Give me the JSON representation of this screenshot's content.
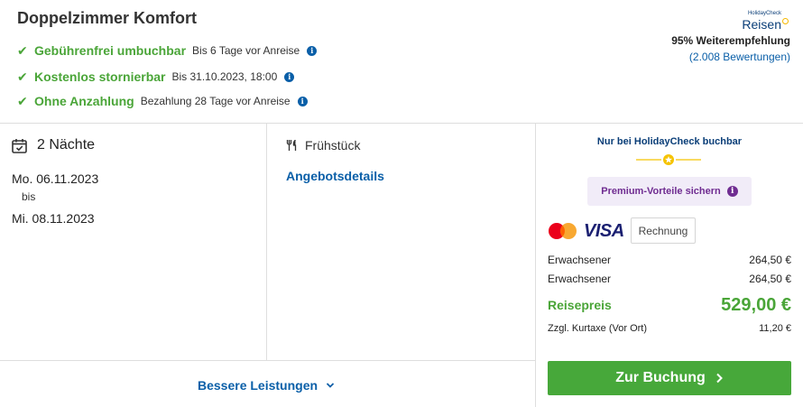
{
  "offer": {
    "title": "Doppelzimmer Komfort",
    "features": [
      {
        "name": "Gebührenfrei umbuchbar",
        "desc": "Bis 6 Tage vor Anreise",
        "info": "i"
      },
      {
        "name": "Kostenlos stornierbar",
        "desc": "Bis 31.10.2023, 18:00",
        "info": "i"
      },
      {
        "name": "Ohne Anzahlung",
        "desc": "Bezahlung 28 Tage vor Anreise",
        "info": "i"
      }
    ]
  },
  "brand": {
    "logo_small": "HolidayCheck",
    "logo_big": "Reisen",
    "recommendation": "95% Weiterempfehlung",
    "reviews": "(2.008 Bewertungen)"
  },
  "stay": {
    "nights_label": "2 Nächte",
    "start_date": "Mo. 06.11.2023",
    "bis": "bis",
    "end_date": "Mi. 08.11.2023"
  },
  "board": {
    "label": "Frühstück",
    "icon": "cutlery-icon",
    "offer_details_link": "Angebotsdetails"
  },
  "footer": {
    "better_services": "Bessere Leistungen"
  },
  "booking": {
    "exclusive_label": "Nur bei HolidayCheck buchbar",
    "premium_label": "Premium-Vorteile sichern",
    "premium_info": "i",
    "payment": {
      "methods": [
        "mastercard",
        "visa"
      ],
      "visa_label": "VISA",
      "invoice_label": "Rechnung"
    },
    "price_rows": [
      {
        "label": "Erwachsener",
        "value": "264,50 €"
      },
      {
        "label": "Erwachsener",
        "value": "264,50 €"
      }
    ],
    "total_label": "Reisepreis",
    "total_value": "529,00 €",
    "tax_label": "Zzgl. Kurtaxe (Vor Ort)",
    "tax_value": "11,20 €",
    "book_button": "Zur Buchung"
  },
  "colors": {
    "green": "#4aa538",
    "link_blue": "#0a5fa8",
    "navy": "#0a3e78",
    "purple": "#6f2c91",
    "purple_bg": "#f1ecf8",
    "star_yellow": "#f5c300",
    "button_green": "#47a83a"
  }
}
